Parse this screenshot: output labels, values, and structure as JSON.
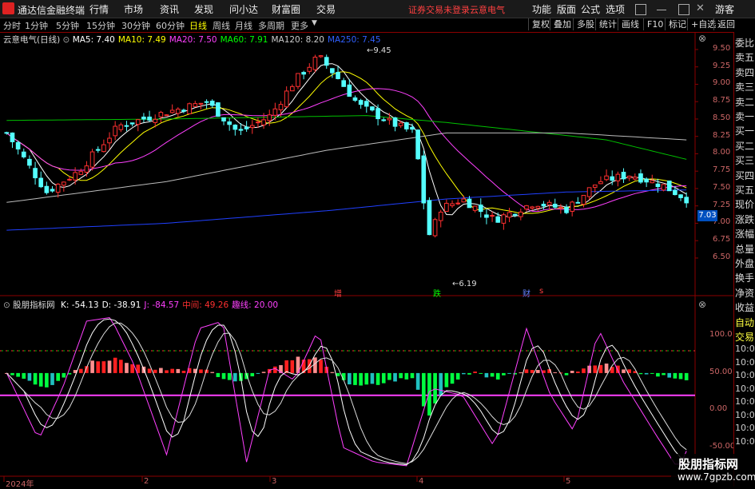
{
  "app": {
    "title": "通达信金融终端",
    "login_status": "证券交易未登录",
    "stock_name_top": "云意电气",
    "guest": "游客"
  },
  "menu": [
    "行情",
    "市场",
    "资讯",
    "发现",
    "问小达",
    "财富圈",
    "交易"
  ],
  "top_right_menu": [
    "功能",
    "版面",
    "公式",
    "选项"
  ],
  "period_tabs": [
    "分时",
    "1分钟",
    "5分钟",
    "15分钟",
    "30分钟",
    "60分钟",
    "日线",
    "周线",
    "月线",
    "多周期",
    "更多"
  ],
  "active_period": "日线",
  "toolbar_buttons": [
    "复权",
    "叠加",
    "多股",
    "统计",
    "画线",
    "F10",
    "标记",
    "+自选",
    "返回"
  ],
  "main_legend": {
    "name": "云意电气(日线)",
    "ma": [
      {
        "label": "MA5: 7.40",
        "color": "#ffffff"
      },
      {
        "label": "MA10: 7.49",
        "color": "#ffff00"
      },
      {
        "label": "MA20: 7.50",
        "color": "#ff40ff"
      },
      {
        "label": "MA60: 7.91",
        "color": "#00ff00"
      },
      {
        "label": "MA120: 8.20",
        "color": "#cccccc"
      },
      {
        "label": "MA250: 7.45",
        "color": "#3060ff"
      }
    ]
  },
  "indicator_legend": {
    "name": "股朋指标网",
    "items": [
      {
        "label": "K: -54.13",
        "color": "#ffffff"
      },
      {
        "label": "D: -38.91",
        "color": "#ffffff"
      },
      {
        "label": "J: -84.57",
        "color": "#ff40ff"
      },
      {
        "label": "中间: 49.26",
        "color": "#ff3030"
      },
      {
        "label": "趣线: 20.00",
        "color": "#ff40ff"
      }
    ]
  },
  "price_axis": [
    "9.50",
    "9.25",
    "9.00",
    "8.75",
    "8.50",
    "8.25",
    "8.00",
    "7.75",
    "7.50",
    "7.25",
    "7.00",
    "6.75",
    "6.50"
  ],
  "indicator_axis": [
    "100.0",
    "50.00",
    "0.00",
    "-50.00"
  ],
  "current_price": "7.03",
  "annotations": {
    "high": "9.45",
    "low": "6.19",
    "zeng": "增",
    "die": "跌",
    "cai": "财",
    "s": "s"
  },
  "time_axis": [
    "2024年",
    "2",
    "3",
    "4",
    "5"
  ],
  "right_panel": [
    "委比",
    "卖五",
    "卖四",
    "卖三",
    "卖二",
    "卖一",
    "买一",
    "买二",
    "买三",
    "买四",
    "买五",
    "现价",
    "涨跌",
    "涨幅",
    "总量",
    "外盘",
    "换手",
    "净资",
    "收益",
    "自动",
    "交易",
    "10:0",
    "10:0",
    "10:0",
    "10:0",
    "10:0",
    "10:0",
    "10:0",
    "10:0"
  ],
  "watermark": {
    "name": "股朋指标网",
    "url": "www.7gpzb.com"
  }
}
